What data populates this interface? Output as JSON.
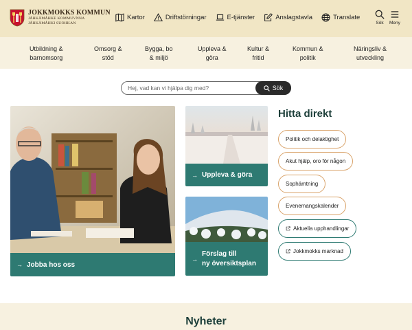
{
  "header": {
    "logo": {
      "line1": "JOKKMOKKS KOMMUN",
      "line2": "JÅHKÅMÅHKE KOMMUVNNA",
      "line3": "JÅHKÅMÅHKI SUOHKAN"
    },
    "links": [
      {
        "label": "Kartor",
        "icon": "map-icon"
      },
      {
        "label": "Driftstörningar",
        "icon": "warning-icon"
      },
      {
        "label": "E-tjänster",
        "icon": "laptop-icon"
      },
      {
        "label": "Anslagstavla",
        "icon": "edit-icon"
      },
      {
        "label": "Translate",
        "icon": "globe-icon"
      }
    ],
    "search_label": "Sök",
    "menu_label": "Meny"
  },
  "nav": [
    {
      "label": "Utbildning &\nbarnomsorg"
    },
    {
      "label": "Omsorg &\nstöd"
    },
    {
      "label": "Bygga, bo\n& miljö"
    },
    {
      "label": "Uppleva &\ngöra"
    },
    {
      "label": "Kultur &\nfritid"
    },
    {
      "label": "Kommun &\npolitik"
    },
    {
      "label": "Näringsliv &\nutveckling"
    }
  ],
  "search": {
    "placeholder": "Hej, vad kan vi hjälpa dig med?",
    "button": "Sök"
  },
  "cards": {
    "jobba": "Jobba hos oss",
    "uppleva": "Uppleva & göra",
    "forslag_line1": "Förslag till",
    "forslag_line2": "ny översiktsplan"
  },
  "hitta": {
    "title": "Hitta direkt",
    "items": [
      {
        "label": "Politik och delaktighet",
        "external": false
      },
      {
        "label": "Akut hjälp, oro för någon",
        "external": false
      },
      {
        "label": "Sophämtning",
        "external": false
      },
      {
        "label": "Evenemangskalender",
        "external": false
      },
      {
        "label": "Aktuella upphandlingar",
        "external": true
      },
      {
        "label": "Jokkmokks marknad",
        "external": true
      }
    ]
  },
  "news": {
    "title": "Nyheter"
  },
  "colors": {
    "header_bg": "#f1e6c5",
    "nav_bg": "#f7f1e0",
    "accent_teal": "#2e7a72",
    "pill_orange": "#d9a36a"
  }
}
